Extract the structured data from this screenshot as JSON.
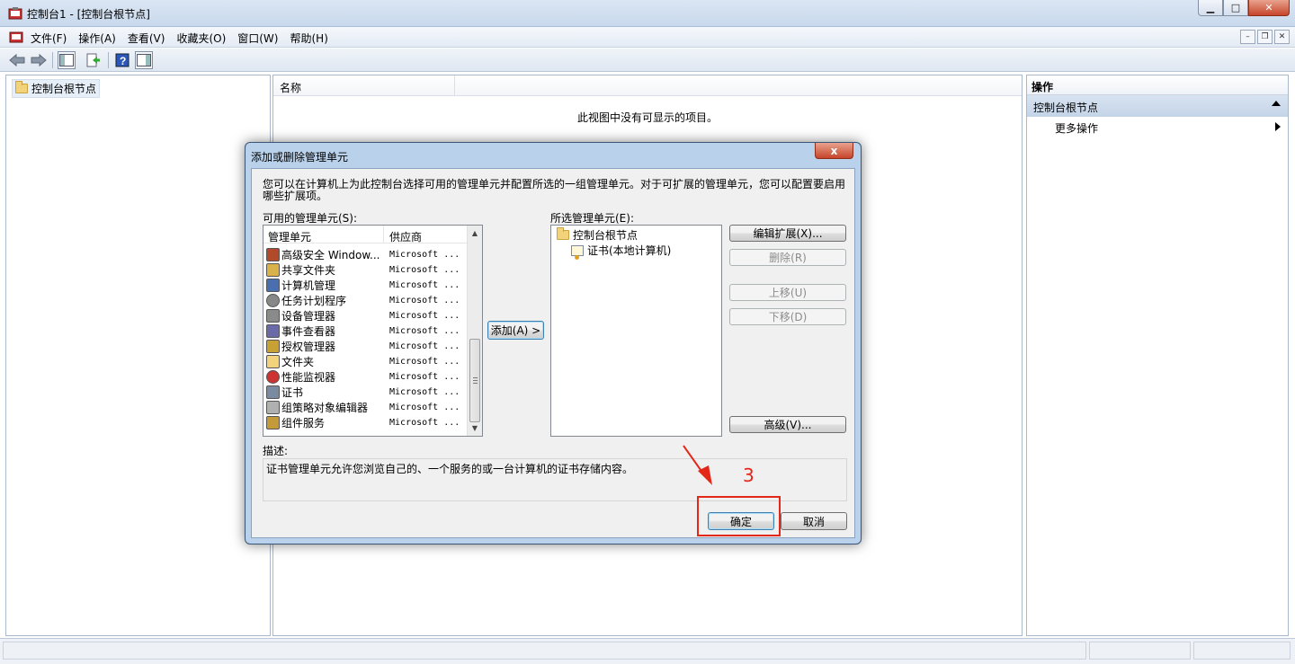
{
  "window": {
    "title": "控制台1 - [控制台根节点]",
    "min_icon": "minimize-icon",
    "max_icon": "maximize-icon",
    "close_icon": "close-icon"
  },
  "menubar": {
    "items": [
      "文件(F)",
      "操作(A)",
      "查看(V)",
      "收藏夹(O)",
      "窗口(W)",
      "帮助(H)"
    ]
  },
  "toolbar": {
    "icons": [
      "back-arrow-icon",
      "forward-arrow-icon",
      "show-hide-tree-icon",
      "export-list-icon",
      "help-icon",
      "show-hide-action-pane-icon"
    ]
  },
  "tree": {
    "root_label": "控制台根节点"
  },
  "center": {
    "column_name": "名称",
    "empty_message": "此视图中没有可显示的项目。"
  },
  "actions": {
    "header": "操作",
    "section": "控制台根节点",
    "more": "更多操作"
  },
  "dialog": {
    "title": "添加或删除管理单元",
    "close_label": "x",
    "intro": "您可以在计算机上为此控制台选择可用的管理单元并配置所选的一组管理单元。对于可扩展的管理单元，您可以配置要启用哪些扩展项。",
    "available_label": "可用的管理单元(S):",
    "selected_label": "所选管理单元(E):",
    "columns": {
      "name": "管理单元",
      "vendor": "供应商"
    },
    "snapins": [
      {
        "name": "高级安全 Window...",
        "vendor": "Microsoft ...",
        "icon": "firewall-icon"
      },
      {
        "name": "共享文件夹",
        "vendor": "Microsoft ...",
        "icon": "shared-folder-icon"
      },
      {
        "name": "计算机管理",
        "vendor": "Microsoft ...",
        "icon": "computer-management-icon"
      },
      {
        "name": "任务计划程序",
        "vendor": "Microsoft ...",
        "icon": "clock-icon"
      },
      {
        "name": "设备管理器",
        "vendor": "Microsoft ...",
        "icon": "device-manager-icon"
      },
      {
        "name": "事件查看器",
        "vendor": "Microsoft ...",
        "icon": "event-viewer-icon"
      },
      {
        "name": "授权管理器",
        "vendor": "Microsoft ...",
        "icon": "authorization-icon"
      },
      {
        "name": "文件夹",
        "vendor": "Microsoft ...",
        "icon": "folder-icon"
      },
      {
        "name": "性能监视器",
        "vendor": "Microsoft ...",
        "icon": "performance-monitor-icon"
      },
      {
        "name": "证书",
        "vendor": "Microsoft ...",
        "icon": "certificate-icon"
      },
      {
        "name": "组策略对象编辑器",
        "vendor": "Microsoft ...",
        "icon": "group-policy-icon"
      },
      {
        "name": "组件服务",
        "vendor": "Microsoft ...",
        "icon": "component-services-icon"
      }
    ],
    "selected_tree": {
      "root": "控制台根节点",
      "child": "证书(本地计算机)"
    },
    "add_button": "添加(A) >",
    "edit_ext_button": "编辑扩展(X)...",
    "remove_button": "删除(R)",
    "up_button": "上移(U)",
    "down_button": "下移(D)",
    "advanced_button": "高级(V)...",
    "desc_label": "描述:",
    "description": "证书管理单元允许您浏览自己的、一个服务的或一台计算机的证书存储内容。",
    "ok_button": "确定",
    "cancel_button": "取消"
  },
  "annotation": {
    "step_number": "3",
    "color": "#e32719"
  }
}
